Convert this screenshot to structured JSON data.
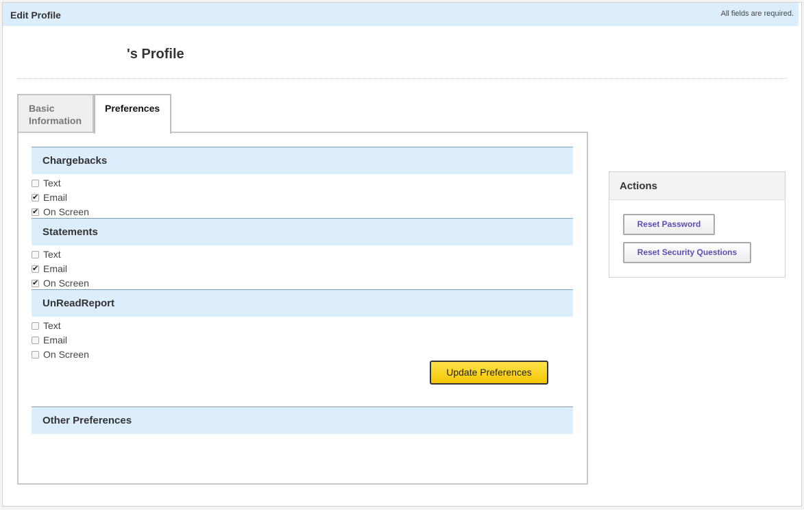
{
  "header": {
    "title": "Edit Profile",
    "required_note": "All fields are required."
  },
  "profile": {
    "title": "'s Profile"
  },
  "tabs": [
    {
      "label_line1": "Basic",
      "label_line2": "Information",
      "active": false
    },
    {
      "label": "Preferences",
      "active": true
    }
  ],
  "sections": [
    {
      "title": "Chargebacks",
      "options": [
        {
          "label": "Text",
          "checked": false
        },
        {
          "label": "Email",
          "checked": true
        },
        {
          "label": "On Screen",
          "checked": true
        }
      ]
    },
    {
      "title": "Statements",
      "options": [
        {
          "label": "Text",
          "checked": false
        },
        {
          "label": "Email",
          "checked": true
        },
        {
          "label": "On Screen",
          "checked": true
        }
      ]
    },
    {
      "title": "UnReadReport",
      "options": [
        {
          "label": "Text",
          "checked": false
        },
        {
          "label": "Email",
          "checked": false
        },
        {
          "label": "On Screen",
          "checked": false
        }
      ]
    }
  ],
  "update_button": "Update Preferences",
  "other_section": "Other Preferences",
  "actions": {
    "title": "Actions",
    "reset_password": "Reset Password",
    "reset_security": "Reset Security Questions"
  },
  "colors": {
    "header_bg": "#dceefc",
    "section_bg": "#dceefc",
    "button_yellow": "#f5c600",
    "action_text": "#5a4db2"
  }
}
